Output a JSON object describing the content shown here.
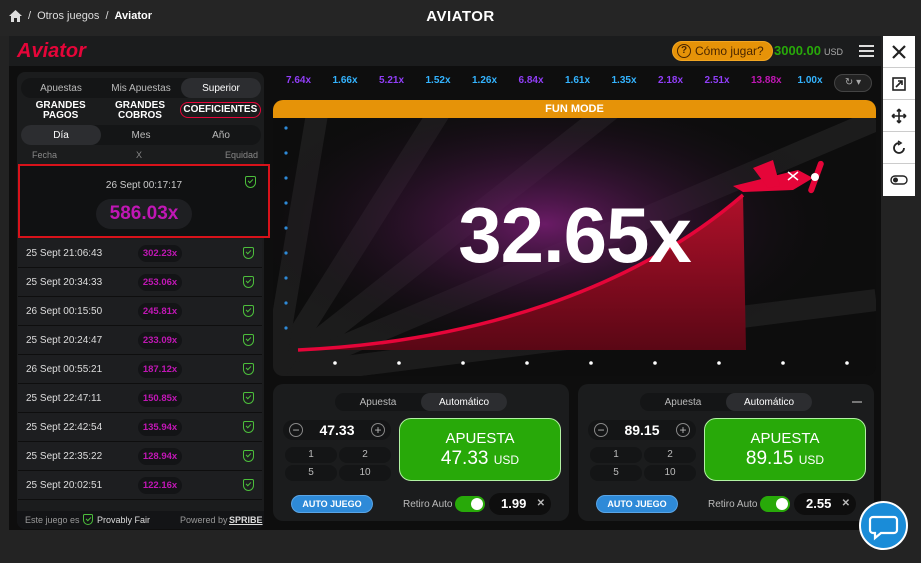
{
  "breadcrumbs": {
    "sep": "/",
    "item1": "Otros juegos",
    "item2": "Aviator"
  },
  "page_title": "AVIATOR",
  "game": {
    "logo": "Aviator",
    "how_to_play": "Cómo jugar?",
    "balance": "3000.00",
    "currency": "USD"
  },
  "left_panel": {
    "main_tabs": [
      "Apuestas",
      "Mis Apuestas",
      "Superior"
    ],
    "sub_tabs": [
      "GRANDES PAGOS",
      "GRANDES COBROS",
      "COEFICIENTES"
    ],
    "period_tabs": [
      "Día",
      "Mes",
      "Año"
    ],
    "columns": {
      "fecha": "Fecha",
      "x": "X",
      "equidad": "Equidad"
    },
    "featured": {
      "date": "26 Sept 00:17:17",
      "multiplier": "586.03x"
    },
    "rows": [
      {
        "date": "25 Sept 21:06:43",
        "x": "302.23x"
      },
      {
        "date": "25 Sept 20:34:33",
        "x": "253.06x"
      },
      {
        "date": "26 Sept 00:15:50",
        "x": "245.81x"
      },
      {
        "date": "25 Sept 20:24:47",
        "x": "233.09x"
      },
      {
        "date": "26 Sept 00:55:21",
        "x": "187.12x"
      },
      {
        "date": "25 Sept 22:47:11",
        "x": "150.85x"
      },
      {
        "date": "25 Sept 22:42:54",
        "x": "135.94x"
      },
      {
        "date": "25 Sept 22:35:22",
        "x": "128.94x"
      },
      {
        "date": "25 Sept 20:02:51",
        "x": "122.16x"
      }
    ],
    "footer": {
      "provably_prefix": "Este juego es",
      "provably": "Provably Fair",
      "powered": "Powered by",
      "brand": "SPRIBE"
    }
  },
  "history": [
    {
      "v": "7.64x",
      "c": "#913ef8"
    },
    {
      "v": "1.66x",
      "c": "#34b4ff"
    },
    {
      "v": "5.21x",
      "c": "#913ef8"
    },
    {
      "v": "1.52x",
      "c": "#34b4ff"
    },
    {
      "v": "1.26x",
      "c": "#34b4ff"
    },
    {
      "v": "6.84x",
      "c": "#913ef8"
    },
    {
      "v": "1.61x",
      "c": "#34b4ff"
    },
    {
      "v": "1.35x",
      "c": "#34b4ff"
    },
    {
      "v": "2.18x",
      "c": "#913ef8"
    },
    {
      "v": "2.51x",
      "c": "#913ef8"
    },
    {
      "v": "13.88x",
      "c": "#c017b4"
    },
    {
      "v": "1.00x",
      "c": "#34b4ff"
    }
  ],
  "stage": {
    "fun_mode": "FUN MODE",
    "multiplier": "32.65x"
  },
  "bet_panels": [
    {
      "tabs": [
        "Apuesta",
        "Automático"
      ],
      "amount": "47.33",
      "quick": [
        "1",
        "2",
        "5",
        "10"
      ],
      "button_label": "APUESTA",
      "button_amount": "47.33",
      "button_currency": "USD",
      "auto_play": "AUTO JUEGO",
      "auto_cashout_label": "Retiro Auto",
      "auto_cashout_value": "1.99"
    },
    {
      "tabs": [
        "Apuesta",
        "Automático"
      ],
      "amount": "89.15",
      "quick": [
        "1",
        "2",
        "5",
        "10"
      ],
      "button_label": "APUESTA",
      "button_amount": "89.15",
      "button_currency": "USD",
      "auto_play": "AUTO JUEGO",
      "auto_cashout_label": "Retiro Auto",
      "auto_cashout_value": "2.55"
    }
  ]
}
